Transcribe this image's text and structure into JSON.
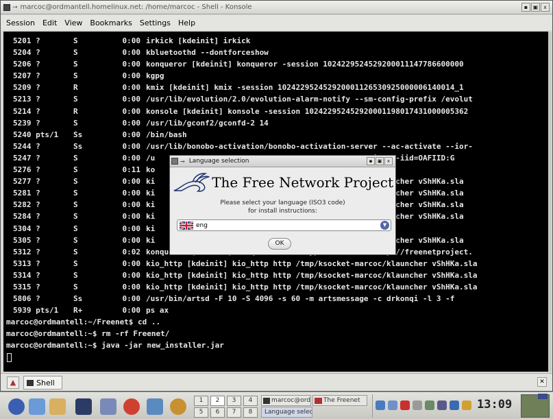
{
  "konsole": {
    "title": "marcoc@ordmantell.homelinux.net: /home/marcoc - Shell - Konsole",
    "title_buttons": [
      "▪",
      "▣",
      "x"
    ],
    "menu": [
      "Session",
      "Edit",
      "View",
      "Bookmarks",
      "Settings",
      "Help"
    ],
    "processes": [
      {
        "pid": "5201 ?",
        "stat": "S",
        "time": "0:00",
        "cmd": "irkick [kdeinit] irkick"
      },
      {
        "pid": "5204 ?",
        "stat": "S",
        "time": "0:00",
        "cmd": "kbluetoothd --dontforceshow"
      },
      {
        "pid": "5206 ?",
        "stat": "S",
        "time": "0:00",
        "cmd": "konqueror [kdeinit] konqueror -session 1024229524529200011147786600000"
      },
      {
        "pid": "5207 ?",
        "stat": "S",
        "time": "0:00",
        "cmd": "kgpg"
      },
      {
        "pid": "5209 ?",
        "stat": "R",
        "time": "0:00",
        "cmd": "kmix [kdeinit] kmix -session 102422952452920001126530925000006140014_1"
      },
      {
        "pid": "5213 ?",
        "stat": "S",
        "time": "0:00",
        "cmd": "/usr/lib/evolution/2.0/evolution-alarm-notify --sm-config-prefix /evolut"
      },
      {
        "pid": "5214 ?",
        "stat": "R",
        "time": "0:00",
        "cmd": "konsole [kdeinit] konsole -session 102422952452920001198017431000005362"
      },
      {
        "pid": "5239 ?",
        "stat": "S",
        "time": "0:00",
        "cmd": "/usr/lib/gconf2/gconfd-2 14"
      },
      {
        "pid": "5240 pts/1",
        "stat": "Ss",
        "time": "0:00",
        "cmd": "/bin/bash"
      },
      {
        "pid": "5244 ?",
        "stat": "Ss",
        "time": "0:00",
        "cmd": "/usr/lib/bonobo-activation/bonobo-activation-server --ac-activate --ior-"
      },
      {
        "pid": "5247 ?",
        "stat": "S",
        "time": "0:00",
        "cmd": "/u                                       --oaf-activate-iid=OAFIID:G"
      },
      {
        "pid": "5276 ?",
        "stat": "S",
        "time": "0:11",
        "cmd": "ko"
      },
      {
        "pid": "5277 ?",
        "stat": "S",
        "time": "0:00",
        "cmd": "ki                                       :-marcoc/klauncher vShHKa.sla"
      },
      {
        "pid": "5281 ?",
        "stat": "S",
        "time": "0:00",
        "cmd": "ki                                       :-marcoc/klauncher vShHKa.sla"
      },
      {
        "pid": "5282 ?",
        "stat": "S",
        "time": "0:00",
        "cmd": "ki                                       :-marcoc/klauncher vShHKa.sla"
      },
      {
        "pid": "5284 ?",
        "stat": "S",
        "time": "0:00",
        "cmd": "ki                                       :-marcoc/klauncher vShHKa.sla"
      },
      {
        "pid": "5304 ?",
        "stat": "S",
        "time": "0:00",
        "cmd": "ki"
      },
      {
        "pid": "5305 ?",
        "stat": "S",
        "time": "0:00",
        "cmd": "ki                                       :-marcoc/klauncher vShHKa.sla"
      },
      {
        "pid": "5312 ?",
        "stat": "S",
        "time": "0:02",
        "cmd": "konqueror [kdeinit] konqueror -mimetype text/html http://freenetproject."
      },
      {
        "pid": "5313 ?",
        "stat": "S",
        "time": "0:00",
        "cmd": "kio_http [kdeinit] kio_http http /tmp/ksocket-marcoc/klauncher vShHKa.sla"
      },
      {
        "pid": "5314 ?",
        "stat": "S",
        "time": "0:00",
        "cmd": "kio_http [kdeinit] kio_http http /tmp/ksocket-marcoc/klauncher vShHKa.sla"
      },
      {
        "pid": "5315 ?",
        "stat": "S",
        "time": "0:00",
        "cmd": "kio_http [kdeinit] kio_http http /tmp/ksocket-marcoc/klauncher vShHKa.sla"
      },
      {
        "pid": "5806 ?",
        "stat": "Ss",
        "time": "0:00",
        "cmd": "/usr/bin/artsd -F 10 -S 4096 -s 60 -m artsmessage -c drkonqi -l 3 -f"
      },
      {
        "pid": "5939 pts/1",
        "stat": "R+",
        "time": "0:00",
        "cmd": "ps ax"
      }
    ],
    "prompts": [
      "marcoc@ordmantell:~/Freenet$ cd ..",
      "marcoc@ordmantell:~$ rm -rf Freenet/",
      "marcoc@ordmantell:~$ java -jar new_installer.jar"
    ],
    "tab_label": "Shell"
  },
  "dialog": {
    "title": "Language selection",
    "title_buttons": [
      "▪",
      "▣",
      "x"
    ],
    "banner": "The Free Network Project",
    "prompt_line1": "Please select your language (ISO3 code)",
    "prompt_line2": "for install instructions:",
    "selected_language": "eng",
    "ok_label": "OK"
  },
  "taskbar": {
    "pager": [
      "1",
      "2",
      "3",
      "4",
      "5",
      "6",
      "7",
      "8"
    ],
    "active_desktop": "2",
    "tasks": [
      {
        "label": "marcoc@ord"
      },
      {
        "label": "The Freenet"
      },
      {
        "label": "Language selec"
      }
    ],
    "clock": "13:09"
  }
}
